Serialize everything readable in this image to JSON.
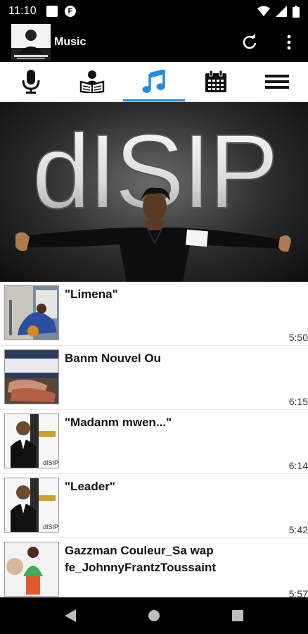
{
  "status_bar": {
    "time": "11:10",
    "icons": [
      "notification-square-icon",
      "app-f-icon",
      "wifi-icon",
      "signal-icon",
      "battery-icon"
    ]
  },
  "app_bar": {
    "title": "Music",
    "actions": [
      "refresh-icon",
      "overflow-menu-icon"
    ],
    "background": "#000000"
  },
  "tabs": [
    {
      "name": "microphone",
      "icon": "microphone-icon",
      "active": false
    },
    {
      "name": "reader",
      "icon": "reader-icon",
      "active": false
    },
    {
      "name": "music",
      "icon": "music-note-icon",
      "active": true
    },
    {
      "name": "calendar",
      "icon": "calendar-icon",
      "active": false
    },
    {
      "name": "menu",
      "icon": "hamburger-icon",
      "active": false
    }
  ],
  "accent_color": "#1a8de0",
  "banner": {
    "text": "dISIP"
  },
  "tracks": [
    {
      "title": "\"Limena\"",
      "duration": "5:50"
    },
    {
      "title": "Banm Nouvel Ou",
      "duration": "6:15"
    },
    {
      "title": "\"Madanm mwen...\"",
      "duration": "6:14"
    },
    {
      "title": "\"Leader\"",
      "duration": "5:42"
    },
    {
      "title": "Gazzman Couleur_Sa wap fe_JohnnyFrantzToussaint",
      "duration": "5:57"
    }
  ],
  "thumb_label": "dISIP",
  "nav_bar": {
    "buttons": [
      "back-icon",
      "home-icon",
      "recents-icon"
    ]
  }
}
